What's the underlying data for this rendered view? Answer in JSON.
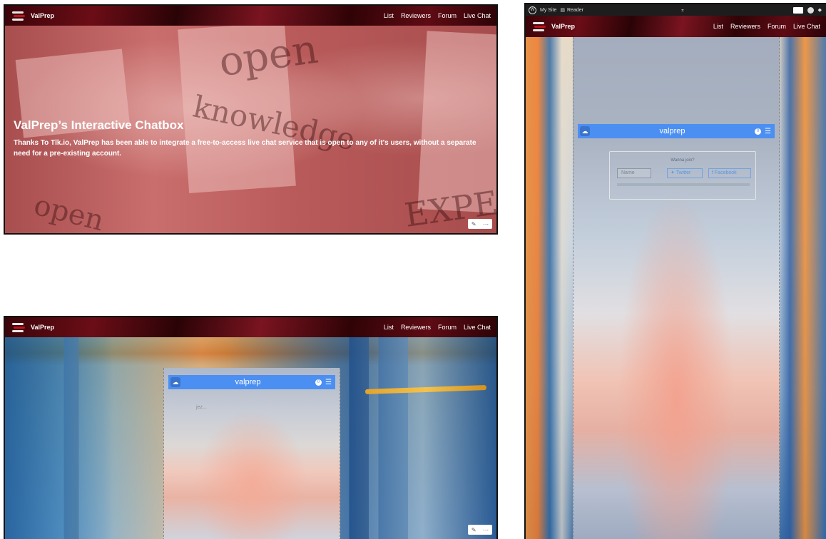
{
  "nav": {
    "brand": "ValPrep",
    "links": [
      "List",
      "Reviewers",
      "Forum",
      "Live Chat"
    ]
  },
  "hero": {
    "title": "ValPrep’s Interactive Chatbox",
    "text": "Thanks To Tlk.io, ValPrep has been able to integrate a free-to-access live chat service that is open to any of it's users, without a separate need for a pre-existing account.",
    "background_words": [
      "open",
      "knowledge",
      "EXPE",
      "open"
    ]
  },
  "chat": {
    "channel": "valprep",
    "count": "0",
    "message": "jez...",
    "join": {
      "title": "Wanna join?",
      "name_placeholder": "Name",
      "twitter": "Twitter",
      "facebook": "Facebook"
    }
  },
  "adminbar": {
    "my_site": "My Site",
    "reader": "Reader"
  },
  "colors": {
    "nav_bg": "#4a0610",
    "chat_bar": "#4c8ff2",
    "hero_overlay": "#b85a5a"
  }
}
